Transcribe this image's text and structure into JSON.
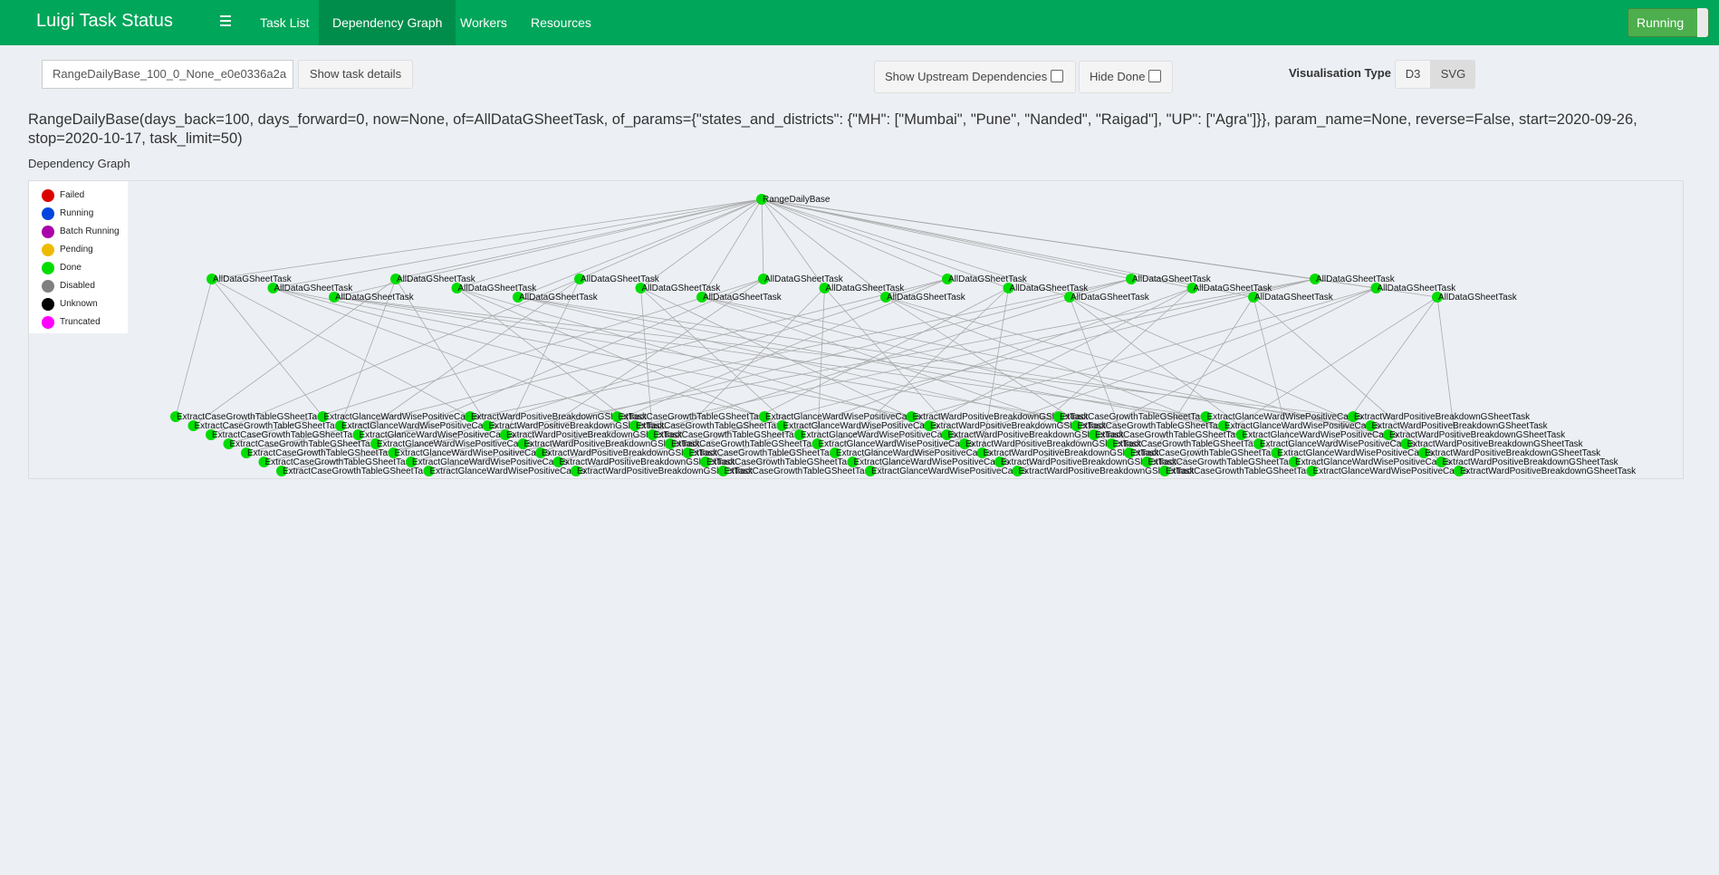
{
  "navbar": {
    "brand": "Luigi Task Status",
    "items": [
      {
        "label": "Task List",
        "active": false
      },
      {
        "label": "Dependency Graph",
        "active": true
      },
      {
        "label": "Workers",
        "active": false
      },
      {
        "label": "Resources",
        "active": false
      }
    ],
    "status_button": "Running"
  },
  "controls": {
    "task_id": "RangeDailyBase_100_0_None_e0e0336a2a",
    "show_details": "Show task details",
    "show_upstream": "Show Upstream Dependencies",
    "hide_done": "Hide Done",
    "vis_type_label": "Visualisation Type",
    "vis_options": [
      "D3",
      "SVG"
    ],
    "vis_selected": "SVG"
  },
  "page": {
    "title": "RangeDailyBase(days_back=100, days_forward=0, now=None, of=AllDataGSheetTask, of_params={\"states_and_districts\": {\"MH\": [\"Mumbai\", \"Pune\", \"Nanded\", \"Raigad\"], \"UP\": [\"Agra\"]}}, param_name=None, reverse=False, start=2020-09-26, stop=2020-10-17, task_limit=50)",
    "subhead": "Dependency Graph"
  },
  "legend": [
    {
      "label": "Failed",
      "color": "#dd0000"
    },
    {
      "label": "Running",
      "color": "#0044dd"
    },
    {
      "label": "Batch Running",
      "color": "#aa00aa"
    },
    {
      "label": "Pending",
      "color": "#eebb00"
    },
    {
      "label": "Done",
      "color": "#00dd00"
    },
    {
      "label": "Disabled",
      "color": "#808080"
    },
    {
      "label": "Unknown",
      "color": "#000000"
    },
    {
      "label": "Truncated",
      "color": "#ff00ff"
    }
  ],
  "graph": {
    "root": {
      "label": "RangeDailyBase",
      "status": "Done"
    },
    "mid_label": "AllDataGSheetTask",
    "mid_count": 21,
    "leaf_labels": [
      "ExtractCaseGrowthTableGSheetTask",
      "ExtractGlanceWardWisePositiveCases",
      "ExtractWardPositiveBreakdownGSheetTask"
    ],
    "done_color": "#00dd00",
    "edge_color": "#aaaaaa"
  }
}
